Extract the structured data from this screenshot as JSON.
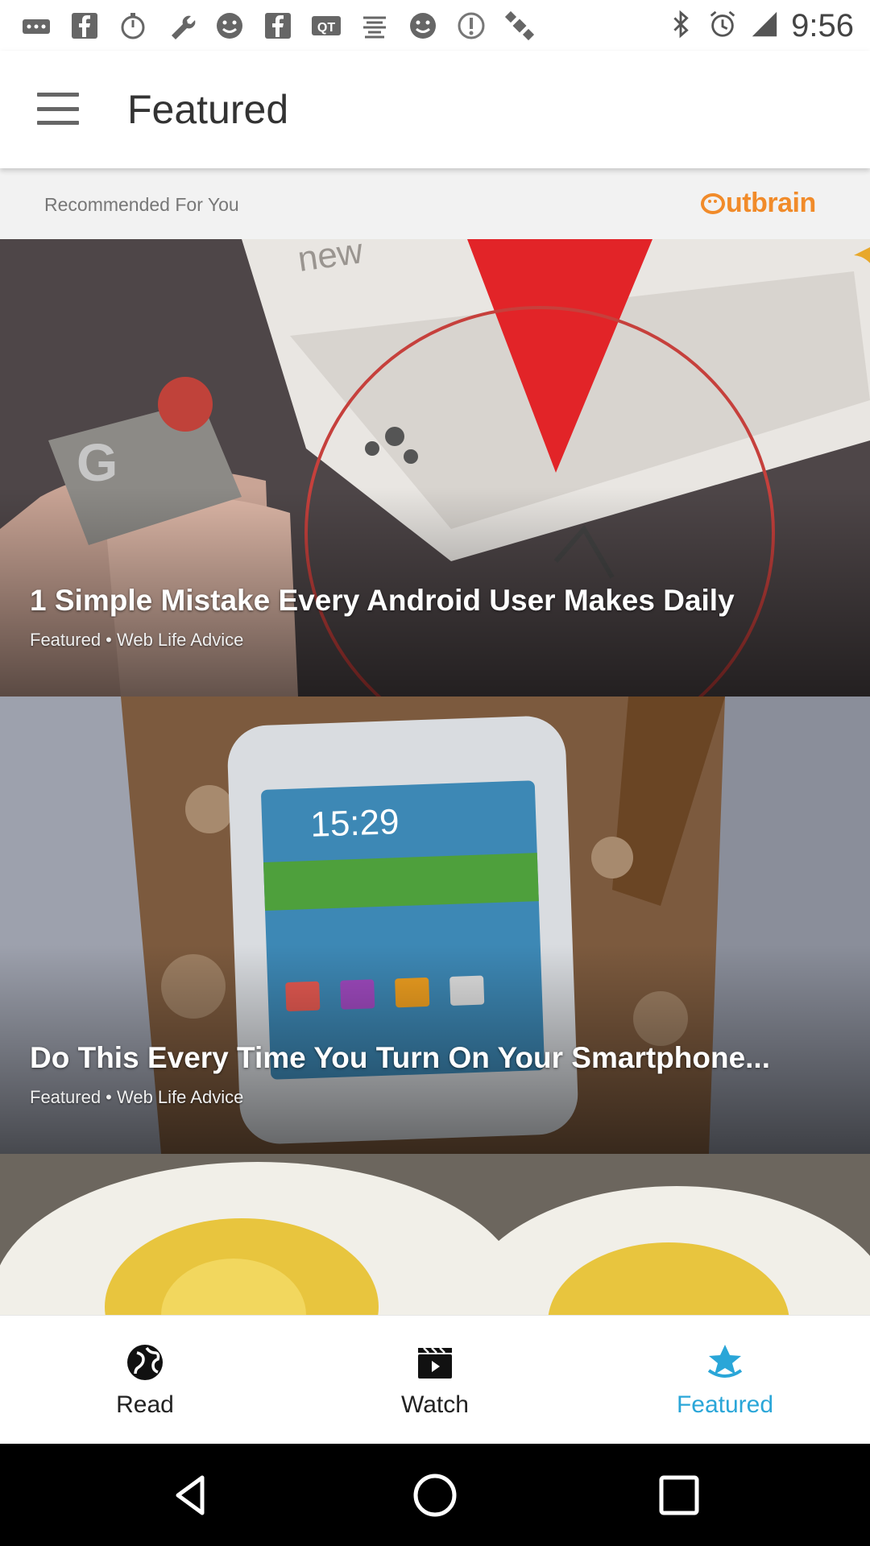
{
  "status_bar": {
    "time": "9:56",
    "left_icons": [
      "more-icon",
      "facebook-icon",
      "timer-icon",
      "wrench-icon",
      "smiley-icon",
      "facebook-icon",
      "qt-icon",
      "app-icon",
      "smiley-icon",
      "info-icon",
      "satellite-icon"
    ],
    "right_icons": [
      "bluetooth-icon",
      "alarm-icon",
      "signal-icon"
    ]
  },
  "toolbar": {
    "title": "Featured"
  },
  "recommendations": {
    "label": "Recommended For You",
    "brand": "utbrain"
  },
  "cards": [
    {
      "title": "1 Simple Mistake Every Android User Makes Daily",
      "meta": "Featured • Web Life Advice"
    },
    {
      "title": "Do This Every Time You Turn On Your Smartphone...",
      "meta": "Featured • Web Life Advice"
    },
    {
      "title": "",
      "meta": ""
    }
  ],
  "bottom_nav": {
    "items": [
      {
        "label": "Read",
        "icon": "globe-icon"
      },
      {
        "label": "Watch",
        "icon": "clapperboard-icon"
      },
      {
        "label": "Featured",
        "icon": "star-icon",
        "active": true
      }
    ],
    "active_color": "#2aa6d8"
  },
  "colors": {
    "brand_orange": "#f18b2a",
    "accent_blue": "#2aa6d8"
  }
}
